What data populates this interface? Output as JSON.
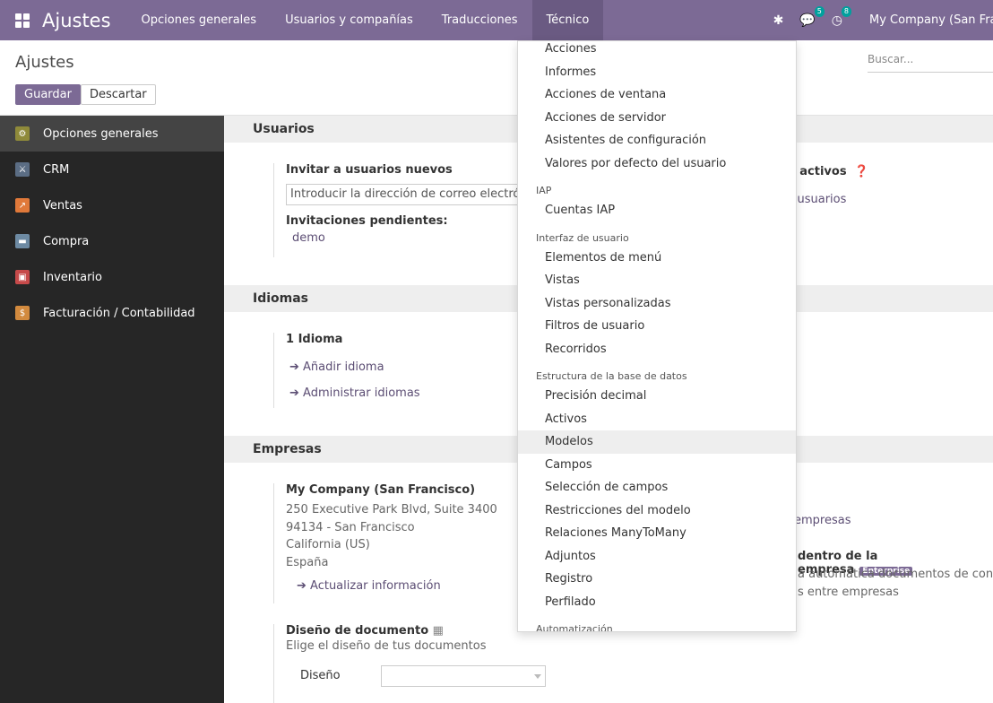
{
  "navbar": {
    "brand": "Ajustes",
    "menus": [
      "Opciones generales",
      "Usuarios y compañías",
      "Traducciones",
      "Técnico"
    ],
    "messages_count": "5",
    "activities_count": "8",
    "company": "My Company (San Francisco)"
  },
  "control": {
    "breadcrumb": "Ajustes",
    "save_label": "Guardar",
    "discard_label": "Descartar",
    "search_placeholder": "Buscar..."
  },
  "sidebar": {
    "items": [
      {
        "label": "Opciones generales",
        "icon": "gear-icon",
        "color": "#8f8a3a"
      },
      {
        "label": "CRM",
        "icon": "handshake-icon",
        "color": "#5b6d84"
      },
      {
        "label": "Ventas",
        "icon": "chart-icon",
        "color": "#e0793a"
      },
      {
        "label": "Compra",
        "icon": "card-icon",
        "color": "#6d8aa3"
      },
      {
        "label": "Inventario",
        "icon": "box-icon",
        "color": "#c64a4a"
      },
      {
        "label": "Facturación / Contabilidad",
        "icon": "invoice-icon",
        "color": "#d28a3e"
      }
    ]
  },
  "main": {
    "usuarios": {
      "title": "Usuarios",
      "invite_label": "Invitar a usuarios nuevos",
      "invite_placeholder": "Introducir la dirección de correo electrónico",
      "pending_label": "Invitaciones pendientes:",
      "pending_user": "demo",
      "right_title": "s activos",
      "right_link": "r usuarios"
    },
    "idiomas": {
      "title": "Idiomas",
      "count_label": "1 Idioma",
      "add_link": "Añadir idioma",
      "manage_link": "Administrar idiomas"
    },
    "empresas": {
      "title": "Empresas",
      "company_name": "My Company (San Francisco)",
      "address": [
        "250 Executive Park Blvd, Suite 3400",
        "94134 - San Francisco",
        "California (US)",
        "España"
      ],
      "update_link": "Actualizar información",
      "right_link": "empresas",
      "right_title": "dentro de la empresa",
      "enterprise_badge": "Enterprise",
      "right_desc1": "a automática documentos de contr",
      "right_desc2": "s entre empresas",
      "layout_title": "Diseño de documento",
      "layout_desc": "Elige el diseño de tus documentos",
      "layout_field_label": "Diseño"
    }
  },
  "dropdown": {
    "groups": [
      {
        "header": "",
        "items": [
          "Acciones",
          "Informes",
          "Acciones de ventana",
          "Acciones de servidor",
          "Asistentes de configuración",
          "Valores por defecto del usuario"
        ]
      },
      {
        "header": "IAP",
        "items": [
          "Cuentas IAP"
        ]
      },
      {
        "header": "Interfaz de usuario",
        "items": [
          "Elementos de menú",
          "Vistas",
          "Vistas personalizadas",
          "Filtros de usuario",
          "Recorridos"
        ]
      },
      {
        "header": "Estructura de la base de datos",
        "items": [
          "Precisión decimal",
          "Activos",
          "Modelos",
          "Campos",
          "Selección de campos",
          "Restricciones del modelo",
          "Relaciones ManyToMany",
          "Adjuntos",
          "Registro",
          "Perfilado"
        ]
      },
      {
        "header": "Automatización",
        "items": []
      }
    ],
    "hovered_item": "Modelos"
  }
}
